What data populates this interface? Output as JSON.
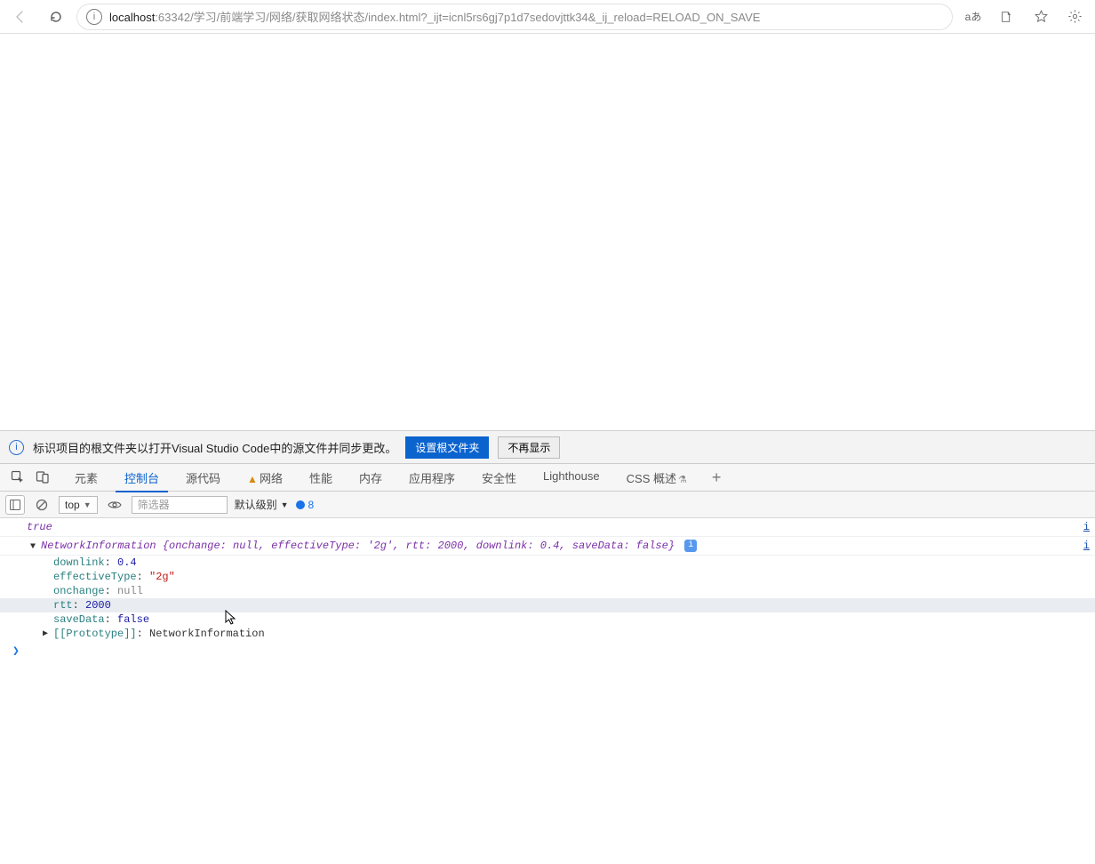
{
  "browser": {
    "url_host": "localhost",
    "url_rest": ":63342/学习/前端学习/网络/获取网络状态/index.html?_ijt=icnl5rs6gj7p1d7sedovjttk34&_ij_reload=RELOAD_ON_SAVE",
    "lang_badge": "aあ"
  },
  "notif": {
    "text": "标识项目的根文件夹以打开Visual Studio Code中的源文件并同步更改。",
    "primary": "设置根文件夹",
    "secondary": "不再显示"
  },
  "devtools_tabs": {
    "elements": "元素",
    "console": "控制台",
    "sources": "源代码",
    "network": "网络",
    "performance": "性能",
    "memory": "内存",
    "application": "应用程序",
    "security": "安全性",
    "lighthouse": "Lighthouse",
    "css_overview": "CSS 概述"
  },
  "console_toolbar": {
    "context": "top",
    "filter_placeholder": "筛选器",
    "level_label": "默认级别",
    "issue_count": "8"
  },
  "console": {
    "line1_value": "true",
    "right_link": "i",
    "obj_name": "NetworkInformation",
    "summary": {
      "k1": "onchange",
      "v1": "null",
      "k2": "effectiveType",
      "v2": "'2g'",
      "k3": "rtt",
      "v3": "2000",
      "k4": "downlink",
      "v4": "0.4",
      "k5": "saveData",
      "v5": "false"
    },
    "props": {
      "downlink_k": "downlink",
      "downlink_v": "0.4",
      "effectiveType_k": "effectiveType",
      "effectiveType_v": "\"2g\"",
      "onchange_k": "onchange",
      "onchange_v": "null",
      "rtt_k": "rtt",
      "rtt_v": "2000",
      "saveData_k": "saveData",
      "saveData_v": "false",
      "proto_k": "[[Prototype]]",
      "proto_v": "NetworkInformation"
    }
  }
}
